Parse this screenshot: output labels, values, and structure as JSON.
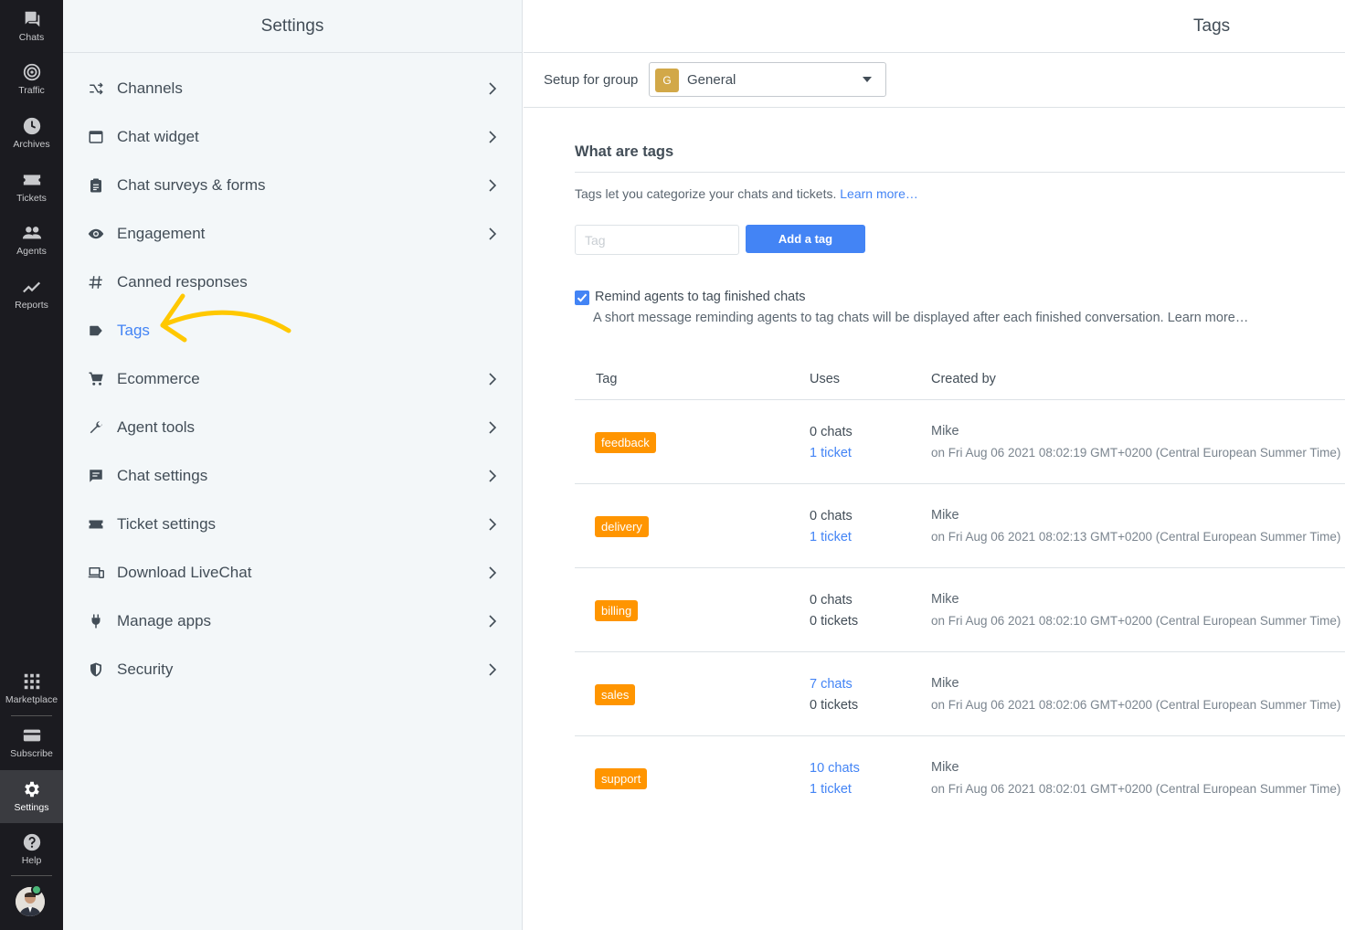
{
  "rail": {
    "items": [
      {
        "label": "Chats",
        "icon": "chat-bubbles-icon"
      },
      {
        "label": "Traffic",
        "icon": "traffic-icon"
      },
      {
        "label": "Archives",
        "icon": "clock-icon"
      },
      {
        "label": "Tickets",
        "icon": "ticket-icon"
      },
      {
        "label": "Agents",
        "icon": "people-icon"
      },
      {
        "label": "Reports",
        "icon": "trend-icon"
      }
    ],
    "bottom": [
      {
        "label": "Marketplace",
        "icon": "grid-icon"
      },
      {
        "label": "Subscribe",
        "icon": "card-icon"
      },
      {
        "label": "Settings",
        "icon": "gear-icon"
      },
      {
        "label": "Help",
        "icon": "help-icon"
      }
    ]
  },
  "settings": {
    "title": "Settings",
    "items": [
      {
        "label": "Channels",
        "icon": "channels-icon"
      },
      {
        "label": "Chat widget",
        "icon": "window-icon"
      },
      {
        "label": "Chat surveys & forms",
        "icon": "clipboard-icon"
      },
      {
        "label": "Engagement",
        "icon": "eye-icon"
      },
      {
        "label": "Canned responses",
        "icon": "hash-icon"
      },
      {
        "label": "Tags",
        "icon": "tag-icon"
      },
      {
        "label": "Ecommerce",
        "icon": "cart-icon"
      },
      {
        "label": "Agent tools",
        "icon": "wrench-icon"
      },
      {
        "label": "Chat settings",
        "icon": "message-icon"
      },
      {
        "label": "Ticket settings",
        "icon": "ticket-icon"
      },
      {
        "label": "Download LiveChat",
        "icon": "devices-icon"
      },
      {
        "label": "Manage apps",
        "icon": "plug-icon"
      },
      {
        "label": "Security",
        "icon": "shield-icon"
      }
    ]
  },
  "main": {
    "title": "Tags",
    "group_label": "Setup for group",
    "group_badge": "G",
    "group_value": "General",
    "section_title": "What are tags",
    "description": "Tags let you categorize your chats and tickets.",
    "learn_more": "Learn more…",
    "tag_placeholder": "Tag",
    "add_button": "Add a tag",
    "remind_label": "Remind agents to tag finished chats",
    "remind_desc": "A short message reminding agents to tag chats will be displayed after each finished conversation. Learn more…",
    "columns": {
      "tag": "Tag",
      "uses": "Uses",
      "created_by": "Created by"
    },
    "rows": [
      {
        "tag": "feedback",
        "chats": "0 chats",
        "tickets": "1 ticket",
        "chats_link": false,
        "tickets_link": true,
        "creator": "Mike",
        "created_at": "on Fri Aug 06 2021 08:02:19 GMT+0200 (Central European Summer Time)"
      },
      {
        "tag": "delivery",
        "chats": "0 chats",
        "tickets": "1 ticket",
        "chats_link": false,
        "tickets_link": true,
        "creator": "Mike",
        "created_at": "on Fri Aug 06 2021 08:02:13 GMT+0200 (Central European Summer Time)"
      },
      {
        "tag": "billing",
        "chats": "0 chats",
        "tickets": "0 tickets",
        "chats_link": false,
        "tickets_link": false,
        "creator": "Mike",
        "created_at": "on Fri Aug 06 2021 08:02:10 GMT+0200 (Central European Summer Time)"
      },
      {
        "tag": "sales",
        "chats": "7 chats",
        "tickets": "0 tickets",
        "chats_link": true,
        "tickets_link": false,
        "creator": "Mike",
        "created_at": "on Fri Aug 06 2021 08:02:06 GMT+0200 (Central European Summer Time)"
      },
      {
        "tag": "support",
        "chats": "10 chats",
        "tickets": "1 ticket",
        "chats_link": true,
        "tickets_link": true,
        "creator": "Mike",
        "created_at": "on Fri Aug 06 2021 08:02:01 GMT+0200 (Central European Summer Time)"
      }
    ]
  },
  "colors": {
    "accent": "#4384f5",
    "tag": "#ff9500",
    "annotation_arrow": "#ffc800"
  }
}
